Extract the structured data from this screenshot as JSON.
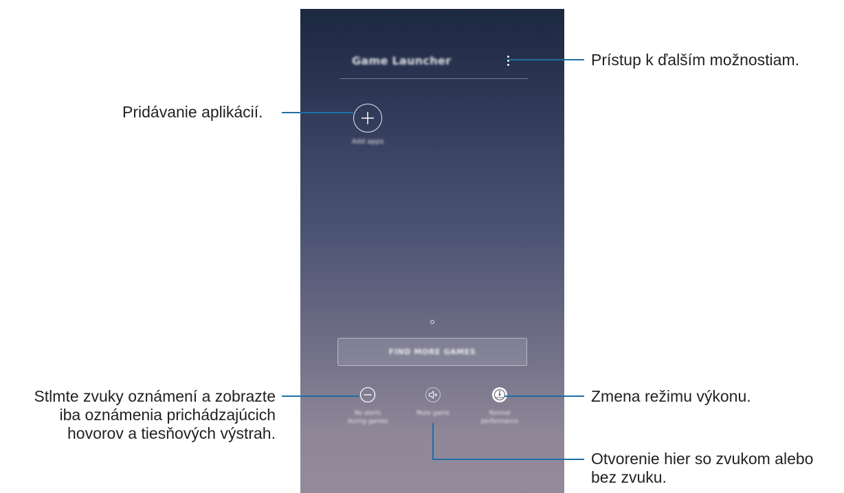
{
  "screen": {
    "title": "Game Launcher",
    "add_apps_label": "Add apps",
    "find_more_games_label": "FIND MORE GAMES",
    "quick_buttons": [
      {
        "icon": "minus-circle-icon",
        "label_line1": "No alerts",
        "label_line2": "during games"
      },
      {
        "icon": "speaker-mute-icon",
        "label_line1": "Mute game",
        "label_line2": ""
      },
      {
        "icon": "speedometer-icon",
        "label_line1": "Normal",
        "label_line2": "performance"
      }
    ]
  },
  "annotations": {
    "more_options": "Prístup k ďalším možnostiam.",
    "add_apps": "Pridávanie aplikácií.",
    "no_alerts_line1": "Stlmte zvuky oznámení a zobrazte",
    "no_alerts_line2": "iba oznámenia prichádzajúcich",
    "no_alerts_line3": "hovorov a tiesňových výstrah.",
    "performance": "Zmena režimu výkonu.",
    "mute_line1": "Otvorenie hier so zvukom alebo",
    "mute_line2": "bez zvuku."
  },
  "colors": {
    "callout_line": "#1d6fa5",
    "annotation_text": "#231f20"
  }
}
